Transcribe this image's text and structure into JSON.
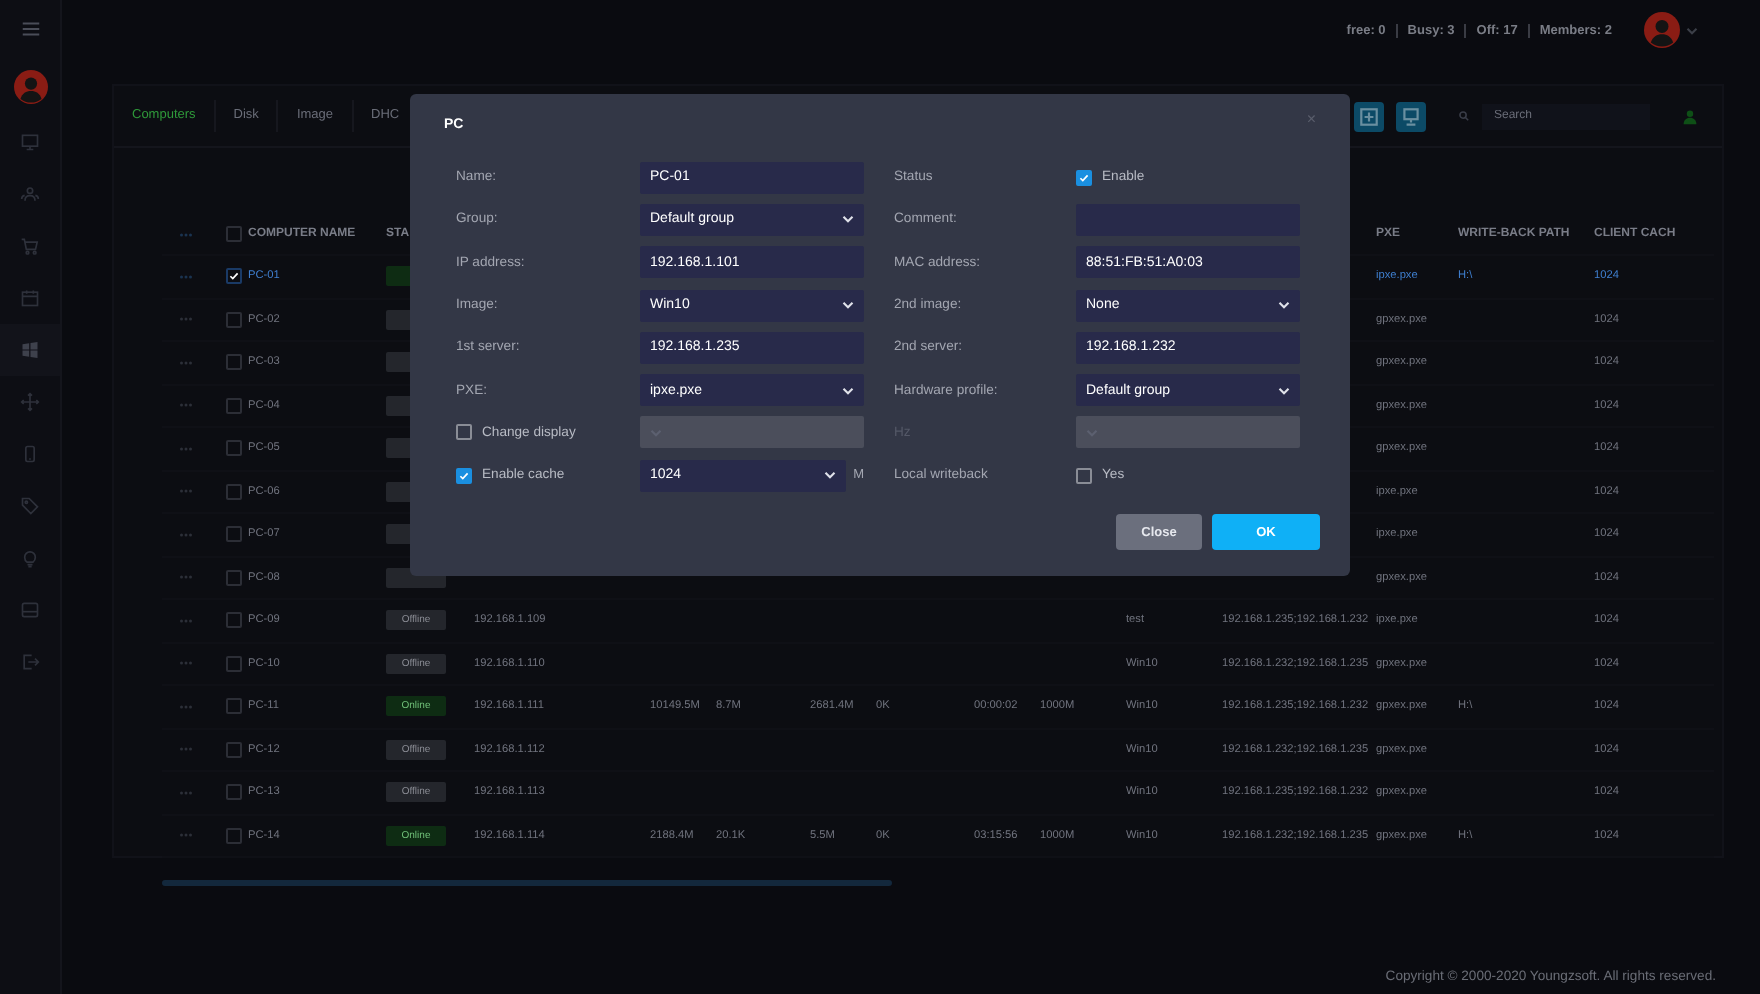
{
  "top_bar": {
    "stats": [
      "free: 0",
      "Busy: 3",
      "Off: 17",
      "Members: 2"
    ]
  },
  "sidebar": {
    "items": [
      {
        "selected": false
      },
      {
        "selected": false
      },
      {
        "selected": false
      },
      {
        "selected": false
      },
      {
        "selected": true
      },
      {
        "selected": false
      },
      {
        "selected": false
      },
      {
        "selected": false
      },
      {
        "selected": false
      },
      {
        "selected": false
      },
      {
        "selected": false
      }
    ]
  },
  "tabs": [
    {
      "label": "Computers",
      "selected": true
    },
    {
      "label": "Disk",
      "selected": false
    },
    {
      "label": "Image",
      "selected": false
    },
    {
      "label": "DHC",
      "selected": false
    }
  ],
  "search": {
    "placeholder": "Search"
  },
  "table": {
    "select_all": {
      "checked": false
    },
    "columns": [
      "COMPUTER NAME",
      "STA",
      "",
      "",
      "",
      "",
      "",
      "",
      "",
      "",
      "",
      "PXE",
      "WRITE-BACK PATH",
      "CLIENT CACH"
    ],
    "rows": [
      {
        "checked": true,
        "selected": true,
        "online": true,
        "cells": [
          "PC-01",
          "",
          "",
          "",
          "",
          "",
          "",
          "",
          "",
          "",
          "",
          "ipxe.pxe",
          "H:\\",
          "1024"
        ]
      },
      {
        "checked": false,
        "selected": false,
        "online": false,
        "cells": [
          "PC-02",
          "",
          "",
          "",
          "",
          "",
          "",
          "",
          "",
          "",
          "",
          "gpxex.pxe",
          "",
          "1024"
        ]
      },
      {
        "checked": false,
        "selected": false,
        "online": false,
        "cells": [
          "PC-03",
          "",
          "",
          "",
          "",
          "",
          "",
          "",
          "",
          "",
          "",
          "gpxex.pxe",
          "",
          "1024"
        ]
      },
      {
        "checked": false,
        "selected": false,
        "online": false,
        "cells": [
          "PC-04",
          "",
          "",
          "",
          "",
          "",
          "",
          "",
          "",
          "",
          "",
          "gpxex.pxe",
          "",
          "1024"
        ]
      },
      {
        "checked": false,
        "selected": false,
        "online": false,
        "cells": [
          "PC-05",
          "",
          "",
          "",
          "",
          "",
          "",
          "",
          "",
          "",
          "",
          "gpxex.pxe",
          "",
          "1024"
        ]
      },
      {
        "checked": false,
        "selected": false,
        "online": false,
        "cells": [
          "PC-06",
          "",
          "",
          "",
          "",
          "",
          "",
          "",
          "",
          "",
          "",
          "ipxe.pxe",
          "",
          "1024"
        ]
      },
      {
        "checked": false,
        "selected": false,
        "online": false,
        "cells": [
          "PC-07",
          "",
          "",
          "",
          "",
          "",
          "",
          "",
          "",
          "",
          "",
          "ipxe.pxe",
          "",
          "1024"
        ]
      },
      {
        "checked": false,
        "selected": false,
        "online": false,
        "cells": [
          "PC-08",
          "",
          "",
          "",
          "",
          "",
          "",
          "",
          "",
          "",
          "",
          "gpxex.pxe",
          "",
          "1024"
        ]
      },
      {
        "checked": false,
        "selected": false,
        "online": false,
        "cells": [
          "PC-09",
          "Offline",
          "192.168.1.109",
          "",
          "",
          "",
          "",
          "",
          "",
          "test",
          "192.168.1.235;192.168.1.232",
          "ipxe.pxe",
          "",
          "1024"
        ]
      },
      {
        "checked": false,
        "selected": false,
        "online": false,
        "cells": [
          "PC-10",
          "Offline",
          "192.168.1.110",
          "",
          "",
          "",
          "",
          "",
          "",
          "Win10",
          "192.168.1.232;192.168.1.235",
          "gpxex.pxe",
          "",
          "1024"
        ]
      },
      {
        "checked": false,
        "selected": false,
        "online": true,
        "cells": [
          "PC-11",
          "Online",
          "192.168.1.111",
          "10149.5M",
          "8.7M",
          "2681.4M",
          "0K",
          "00:00:02",
          "1000M",
          "Win10",
          "192.168.1.235;192.168.1.232",
          "gpxex.pxe",
          "H:\\",
          "1024"
        ]
      },
      {
        "checked": false,
        "selected": false,
        "online": false,
        "cells": [
          "PC-12",
          "Offline",
          "192.168.1.112",
          "",
          "",
          "",
          "",
          "",
          "",
          "Win10",
          "192.168.1.232;192.168.1.235",
          "gpxex.pxe",
          "",
          "1024"
        ]
      },
      {
        "checked": false,
        "selected": false,
        "online": false,
        "cells": [
          "PC-13",
          "Offline",
          "192.168.1.113",
          "",
          "",
          "",
          "",
          "",
          "",
          "Win10",
          "192.168.1.235;192.168.1.232",
          "gpxex.pxe",
          "",
          "1024"
        ]
      },
      {
        "checked": false,
        "selected": false,
        "online": true,
        "cells": [
          "PC-14",
          "Online",
          "192.168.1.114",
          "2188.4M",
          "20.1K",
          "5.5M",
          "0K",
          "03:15:56",
          "1000M",
          "Win10",
          "192.168.1.232;192.168.1.235",
          "gpxex.pxe",
          "H:\\",
          "1024"
        ]
      }
    ]
  },
  "dialog": {
    "title": "PC",
    "close": "×",
    "left": [
      {
        "kind": "text",
        "label": "Name:",
        "value": "PC-01"
      },
      {
        "kind": "select",
        "label": "Group:",
        "value": "Default group"
      },
      {
        "kind": "text",
        "label": "IP address:",
        "value": "192.168.1.101"
      },
      {
        "kind": "select",
        "label": "Image:",
        "value": "Win10"
      },
      {
        "kind": "text",
        "label": "1st server:",
        "value": "192.168.1.235"
      },
      {
        "kind": "select",
        "label": "PXE:",
        "value": "ipxe.pxe"
      },
      {
        "kind": "check_select",
        "label": "Change display",
        "checked": false,
        "disabled": true
      },
      {
        "kind": "check_select",
        "label": "Enable cache",
        "checked": true,
        "disabled": false,
        "value": "1024",
        "unit": "M"
      }
    ],
    "right": [
      {
        "kind": "check",
        "label": "Status",
        "checked": true,
        "option": "Enable"
      },
      {
        "kind": "text",
        "label": "Comment:"
      },
      {
        "kind": "text",
        "label": "MAC address:",
        "value": "88:51:FB:51:A0:03"
      },
      {
        "kind": "select",
        "label": "2nd image:",
        "value": "None"
      },
      {
        "kind": "text",
        "label": "2nd server:",
        "value": "192.168.1.232"
      },
      {
        "kind": "select",
        "label": "Hardware profile:",
        "value": "Default group"
      },
      {
        "kind": "select",
        "label": "Hz",
        "disabled": true
      },
      {
        "kind": "check",
        "label": "Local writeback",
        "checked": false,
        "option": "Yes"
      }
    ],
    "buttons": [
      {
        "label": "Close",
        "kind": "secondary"
      },
      {
        "label": "OK",
        "kind": "primary"
      }
    ]
  },
  "footer": {
    "text": "Copyright © 2000-2020 Youngzsoft. All rights reserved."
  }
}
